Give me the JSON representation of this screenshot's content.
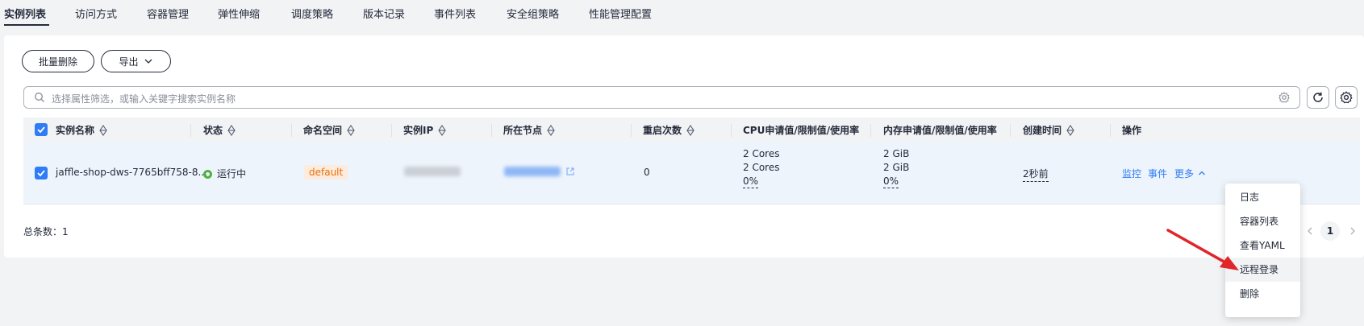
{
  "tabs": [
    "实例列表",
    "访问方式",
    "容器管理",
    "弹性伸缩",
    "调度策略",
    "版本记录",
    "事件列表",
    "安全组策略",
    "性能管理配置"
  ],
  "toolbar": {
    "batch_delete": "批量删除",
    "export": "导出"
  },
  "search": {
    "placeholder": "选择属性筛选，或输入关键字搜索实例名称"
  },
  "table": {
    "headers": [
      "实例名称",
      "状态",
      "命名空间",
      "实例IP",
      "所在节点",
      "重启次数",
      "CPU申请值/限制值/使用率",
      "内存申请值/限制值/使用率",
      "创建时间",
      "操作"
    ],
    "row": {
      "name": "jaffle-shop-dws-7765bff758-8...",
      "status": "运行中",
      "namespace": "default",
      "restarts": "0",
      "cpu": [
        "2 Cores",
        "2 Cores",
        "0%"
      ],
      "memory": [
        "2 GiB",
        "2 GiB",
        "0%"
      ],
      "created": "2秒前",
      "actions": {
        "monitor": "监控",
        "events": "事件",
        "more": "更多"
      }
    }
  },
  "footer": {
    "total": "总条数：1",
    "page": "1"
  },
  "dropdown": {
    "items": [
      "日志",
      "容器列表",
      "查看YAML",
      "远程登录",
      "删除"
    ],
    "highlighted": "远程登录"
  },
  "colors": {
    "primary": "#2e7cf6",
    "running": "#50b142",
    "namespace_tag": "#e8710a",
    "arrow": "#e0262b"
  }
}
